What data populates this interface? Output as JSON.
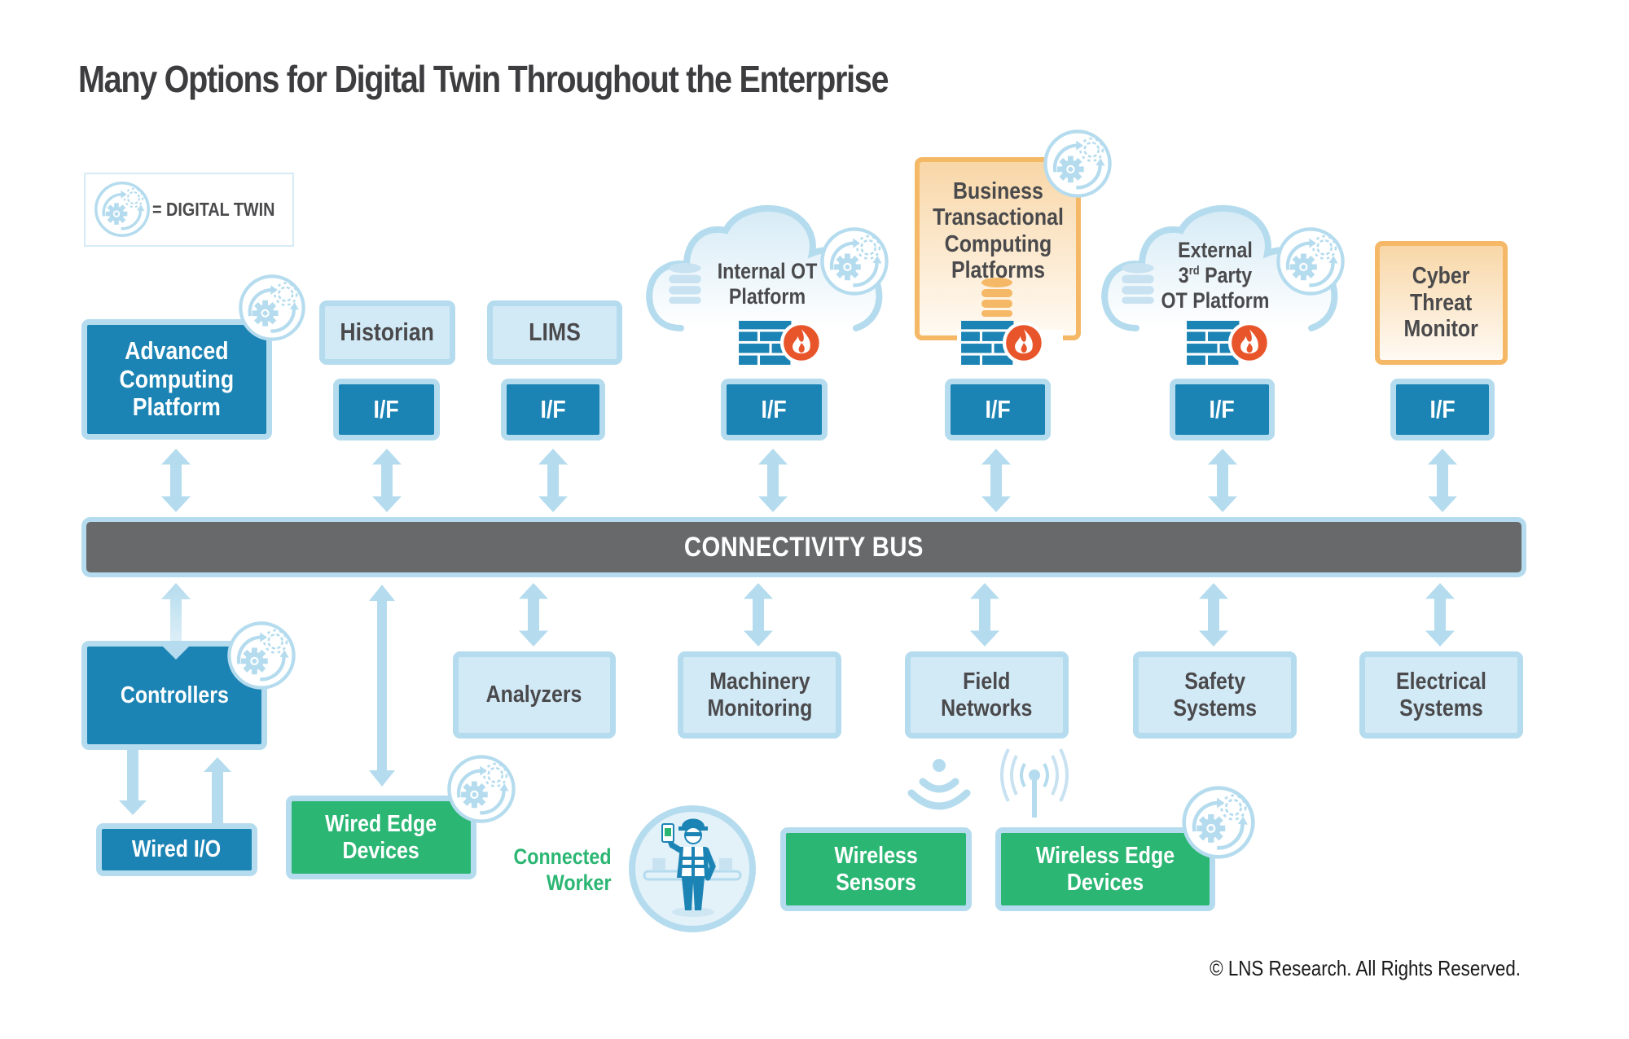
{
  "title": "Many Options for Digital Twin Throughout the Enterprise",
  "legend": {
    "icon": "digital-twin-gear-icon",
    "label": "= DIGITAL TWIN"
  },
  "colors": {
    "dark_blue": "#1c84b4",
    "light_blue": "#d2e9f6",
    "border_blue": "#b5dcee",
    "green": "#2bb673",
    "orange_border": "#f5b866",
    "bus_gray": "#68696b",
    "firewall_red": "#e8552b",
    "text_gray": "#4a4a4c"
  },
  "top_row": {
    "advanced": {
      "label": "Advanced\nComputing\nPlatform",
      "digital_twin": true
    },
    "historian": {
      "label": "Historian",
      "interface": "I/F"
    },
    "lims": {
      "label": "LIMS",
      "interface": "I/F"
    },
    "internal_ot": {
      "label_line1": "Internal OT",
      "label_line2": "Platform",
      "interface": "I/F",
      "digital_twin": true,
      "firewall": true,
      "database": true
    },
    "business": {
      "label": "Business\nTransactional\nComputing\nPlatforms",
      "interface": "I/F",
      "digital_twin": true,
      "firewall": true,
      "database": true
    },
    "external": {
      "label_line1": "External",
      "label_line2_pre": "3",
      "label_line2_sup": "rd",
      "label_line2_post": " Party",
      "label_line3": "OT Platform",
      "interface": "I/F",
      "digital_twin": true,
      "firewall": true,
      "database": true
    },
    "cyber": {
      "label": "Cyber\nThreat\nMonitor",
      "interface": "I/F"
    }
  },
  "bus": {
    "label": "CONNECTIVITY BUS"
  },
  "bottom_row": {
    "controllers": {
      "label": "Controllers",
      "digital_twin": true
    },
    "wired_io": {
      "label": "Wired I/O"
    },
    "wired_edge": {
      "label": "Wired Edge\nDevices",
      "digital_twin": true
    },
    "analyzers": {
      "label": "Analyzers"
    },
    "machinery": {
      "label": "Machinery\nMonitoring"
    },
    "field_networks": {
      "label": "Field\nNetworks"
    },
    "safety": {
      "label": "Safety\nSystems"
    },
    "electrical": {
      "label": "Electrical\nSystems"
    },
    "connected_worker": {
      "label": "Connected\nWorker"
    },
    "wireless_sensors": {
      "label": "Wireless\nSensors"
    },
    "wireless_edge": {
      "label": "Wireless Edge\nDevices",
      "digital_twin": true
    }
  },
  "copyright": "© LNS Research. All Rights Reserved."
}
